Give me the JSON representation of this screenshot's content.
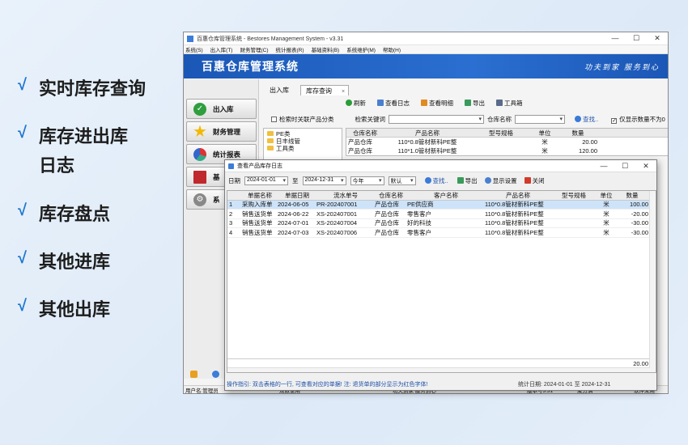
{
  "features": [
    "实时库存查询",
    "库存进出库",
    "日志",
    "库存盘点",
    "其他进库",
    "其他出库"
  ],
  "check_mark": "√",
  "window": {
    "title": "百惠仓库管理系统 - Bestores Management System - v3.31",
    "menu": [
      "系统(S)",
      "出入库(T)",
      "财务管理(C)",
      "统计报表(R)",
      "基础资料(B)",
      "系统维护(M)",
      "帮助(H)"
    ],
    "banner_title": "百惠仓库管理系统",
    "slogan": "功夫到家  服务到心",
    "nav": [
      "出入库",
      "财务管理",
      "统计报表",
      "基",
      "系"
    ],
    "tabs": [
      "出入库",
      "库存查询"
    ],
    "tab_close": "×",
    "toolbar": [
      "刷新",
      "查看日志",
      "查看明细",
      "导出",
      "工具箱"
    ],
    "search_related_label": "检索时关联产品分类",
    "search_keyword_label": "检索关键词",
    "warehouse_label": "仓库名称",
    "find_label": "查找..",
    "only_show_label": "仅显示数量不为0",
    "tree": [
      "PE类",
      "日丰线管",
      "工具类"
    ],
    "grid": {
      "headers": [
        "仓库名称",
        "产品名称",
        "型号规格",
        "单位",
        "数量"
      ],
      "rows": [
        [
          "产品仓库",
          "110*0.8管材新科PE整",
          "",
          "米",
          "20.00"
        ],
        [
          "产品仓库",
          "110*1.0管材新科PE整",
          "",
          "米",
          "120.00"
        ]
      ]
    },
    "status": [
      "用户名:管理员",
      "双数使用",
      "功夫到家 服务到心",
      "版本号3.31",
      "聚分满",
      "52216",
      "软件来用"
    ]
  },
  "dialog": {
    "title": "查看产品库存日志",
    "date_label": "日期",
    "date_from": "2024-01-01",
    "to_label": "至",
    "date_to": "2024-12-31",
    "period": "今年",
    "sort": "默认",
    "find": "查找..",
    "export": "导出",
    "display_settings": "显示设置",
    "close": "关闭",
    "headers": [
      "单据名称",
      "单据日期",
      "流水单号",
      "仓库名称",
      "客户名称",
      "产品名称",
      "型号规格",
      "单位",
      "数量"
    ],
    "rows": [
      [
        "1",
        "采购入库单",
        "2024-06-05",
        "PR-202407001",
        "产品仓库",
        "PE供应商",
        "110*0.8管材新科PE整",
        "",
        "米",
        "100.00"
      ],
      [
        "2",
        "销售送货单",
        "2024-06-22",
        "XS-202407001",
        "产品仓库",
        "零售客户",
        "110*0.8管材新科PE整",
        "",
        "米",
        "-20.00"
      ],
      [
        "3",
        "销售送货单",
        "2024-07-01",
        "XS-202407004",
        "产品仓库",
        "好的科技",
        "110*0.8管材新科PE整",
        "",
        "米",
        "-30.00"
      ],
      [
        "4",
        "销售送货单",
        "2024-07-03",
        "XS-202407006",
        "产品仓库",
        "零售客户",
        "110*0.8管材新科PE整",
        "",
        "米",
        "-30.00"
      ]
    ],
    "total": "20.00",
    "hint": "操作指引: 双击表格的一行, 可查看对应的单据! 注: 退货单的部分显示为红色字体!",
    "stat_date": "统计日期: 2024-01-01 至 2024-12-31"
  }
}
